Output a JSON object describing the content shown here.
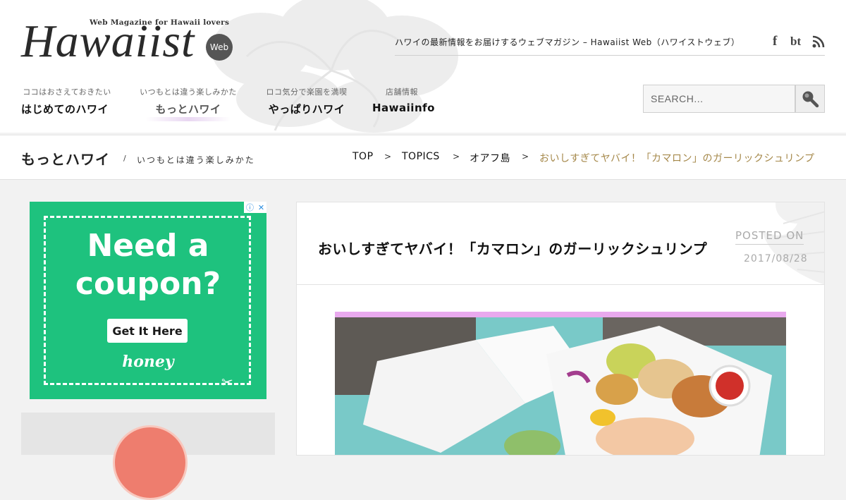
{
  "header": {
    "logo_tagline": "Web Magazine for Hawaii lovers",
    "logo_word": "Hawaiist",
    "logo_badge": "Web",
    "site_description": "ハワイの最新情報をお届けするウェブマガジン – Hawaiist Web（ハワイストウェブ）",
    "social_icons": [
      "facebook-icon",
      "bt-icon",
      "rss-icon"
    ],
    "nav": [
      {
        "sub": "ココはおさえておきたい",
        "label": "はじめてのハワイ"
      },
      {
        "sub": "いつもとは違う楽しみかた",
        "label": "もっとハワイ"
      },
      {
        "sub": "ロコ気分で楽園を満喫",
        "label": "やっぱりハワイ"
      },
      {
        "sub": "店舗情報",
        "label": "Hawaiinfo"
      }
    ],
    "search": {
      "placeholder": "SEARCH..."
    }
  },
  "page_heading": {
    "title": "もっとハワイ",
    "separator": "/",
    "subtitle": "いつもとは違う楽しみかた"
  },
  "breadcrumb": [
    {
      "label": "TOP"
    },
    {
      "label": "TOPICS"
    },
    {
      "label": "オアフ島"
    },
    {
      "label": "おいしすぎてヤバイ！「カマロン」のガーリックシュリンプ"
    }
  ],
  "breadcrumb_separator": ">",
  "ad": {
    "headline_line1": "Need a",
    "headline_line2": "coupon?",
    "cta": "Get It Here",
    "brand": "honey",
    "accent": "#1ec27e"
  },
  "article": {
    "title": "おいしすぎてヤバイ！「カマロン」のガーリックシュリンプ",
    "posted_label": "POSTED ON",
    "posted_date": "2017/08/28"
  },
  "colors": {
    "breadcrumb_current": "#a5884a",
    "background": "#f2f2f2"
  }
}
